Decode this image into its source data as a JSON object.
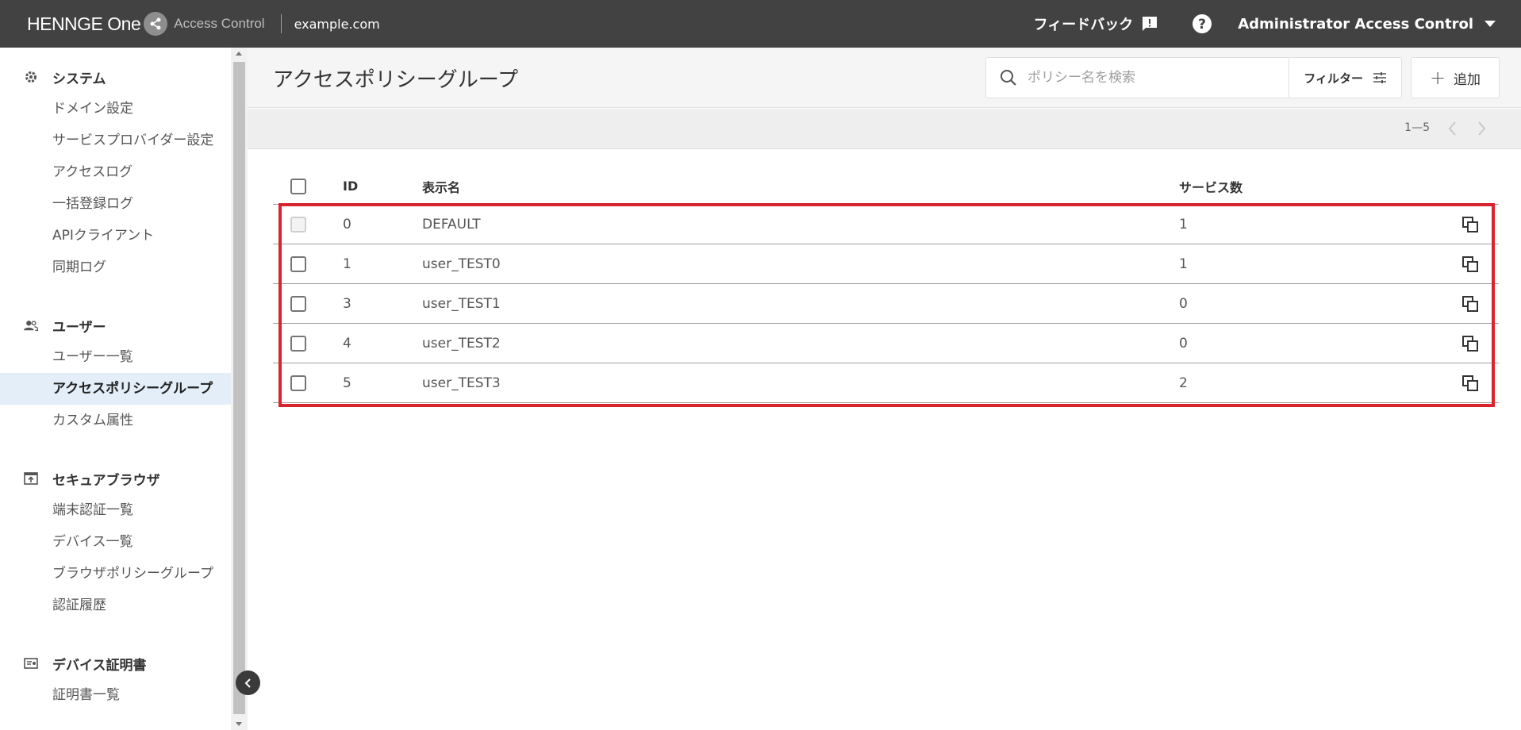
{
  "header": {
    "logo_text": "HENNGE One",
    "product": "Access Control",
    "domain": "example.com",
    "feedback_label": "フィードバック",
    "account_label": "Administrator Access Control"
  },
  "sidebar": {
    "sections": [
      {
        "title": "システム",
        "icon": "gear-icon",
        "items": [
          "ドメイン設定",
          "サービスプロバイダー設定",
          "アクセスログ",
          "一括登録ログ",
          "APIクライアント",
          "同期ログ"
        ]
      },
      {
        "title": "ユーザー",
        "icon": "users-icon",
        "items": [
          "ユーザー一覧",
          "アクセスポリシーグループ",
          "カスタム属性"
        ]
      },
      {
        "title": "セキュアブラウザ",
        "icon": "secure-browser-icon",
        "items": [
          "端末認証一覧",
          "デバイス一覧",
          "ブラウザポリシーグループ",
          "認証履歴"
        ]
      },
      {
        "title": "デバイス証明書",
        "icon": "certificate-icon",
        "items": [
          "証明書一覧"
        ]
      }
    ],
    "active_item": "アクセスポリシーグループ"
  },
  "page": {
    "title": "アクセスポリシーグループ",
    "search_placeholder": "ポリシー名を検索",
    "filter_label": "フィルター",
    "add_label": "追加",
    "pager_range": "1—5"
  },
  "table": {
    "columns": {
      "id": "ID",
      "name": "表示名",
      "services": "サービス数"
    },
    "rows": [
      {
        "id": "0",
        "name": "DEFAULT",
        "services": "1",
        "disabled": true
      },
      {
        "id": "1",
        "name": "user_TEST0",
        "services": "1",
        "disabled": false
      },
      {
        "id": "3",
        "name": "user_TEST1",
        "services": "0",
        "disabled": false
      },
      {
        "id": "4",
        "name": "user_TEST2",
        "services": "0",
        "disabled": false
      },
      {
        "id": "5",
        "name": "user_TEST3",
        "services": "2",
        "disabled": false
      }
    ]
  },
  "colors": {
    "topbar": "#424242",
    "active_nav": "#e3eef9",
    "highlight": "#d9232e"
  }
}
